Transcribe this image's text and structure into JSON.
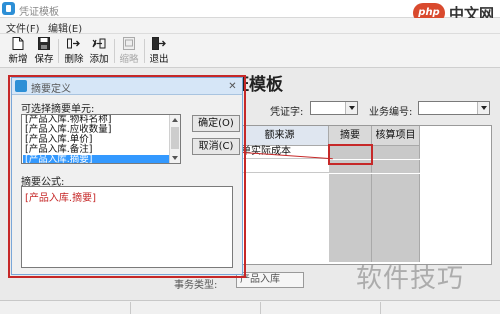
{
  "app": {
    "title": "凭证模板"
  },
  "brand": {
    "logo": "php",
    "text": "中文网"
  },
  "menu": [
    "文件(F)",
    "编辑(E)"
  ],
  "toolbar": [
    {
      "label": "新增",
      "icon": "new-file-icon",
      "enabled": true
    },
    {
      "label": "保存",
      "icon": "save-icon",
      "enabled": true
    },
    {
      "label": "删除",
      "icon": "delete-icon",
      "enabled": true
    },
    {
      "label": "添加",
      "icon": "add-icon",
      "enabled": true
    },
    {
      "label": "缩略",
      "icon": "thumbnail-icon",
      "enabled": false
    },
    {
      "label": "退出",
      "icon": "exit-icon",
      "enabled": true
    }
  ],
  "form": {
    "title": "证模板",
    "voucher_label": "凭证字:",
    "voucher_value": "",
    "business_label": "业务编号:",
    "business_value": ""
  },
  "grid": {
    "headers": [
      "额来源",
      "摘要",
      "核算项目"
    ],
    "rows": [
      {
        "source": "原单实际成本",
        "summary": "",
        "item": ""
      },
      {
        "source": "",
        "summary": "",
        "item": ""
      }
    ]
  },
  "bottom": {
    "label": "事务类型:",
    "value": "产品入库"
  },
  "dialog": {
    "title": "摘要定义",
    "available_label": "可选择摘要单元:",
    "items": [
      "[产品入库.物料名称]",
      "[产品入库.应收数量]",
      "[产品入库.单价]",
      "[产品入库.备注]",
      "[产品入库.摘要]"
    ],
    "selected_index": 4,
    "ok_label": "确定(O)",
    "cancel_label": "取消(C)",
    "formula_label": "摘要公式:",
    "formula_value": "[产品入库.摘要]"
  },
  "watermark": "软件技巧",
  "colors": {
    "highlight": "#c62828",
    "selection": "#3399ff",
    "accent": "#2d8fd6"
  }
}
